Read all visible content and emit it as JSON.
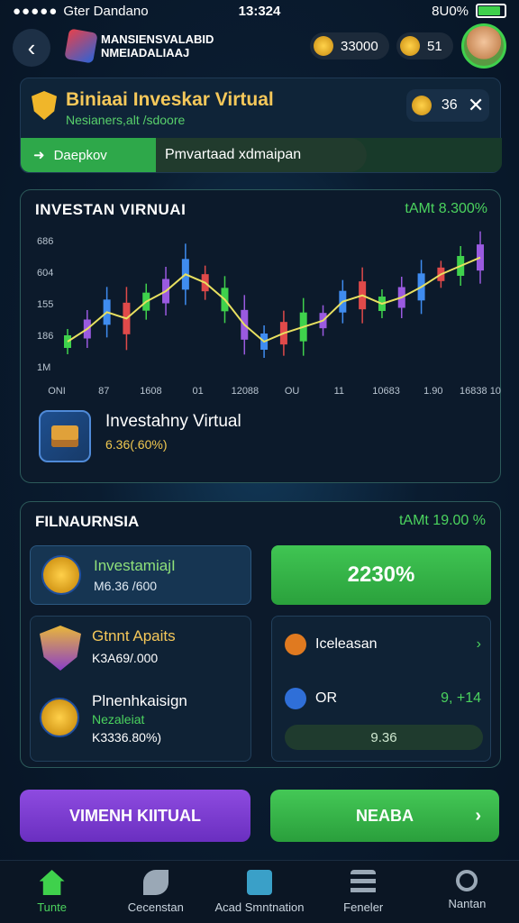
{
  "status_bar": {
    "carrier": "Gter Dandano",
    "time": "13:324",
    "battery": "8U0%"
  },
  "header": {
    "app_name": "MANSIENSVALABID NMEIADALIAAJ",
    "coins": "33000",
    "gems": "51"
  },
  "title_card": {
    "title": "Biniaai Inveskar Virtual",
    "subtitle": "Nesianers,alt /sdoore",
    "badge_value": "36",
    "tabs": [
      {
        "label": "Daepkov"
      },
      {
        "label": "Pmvartaad xdmaipan"
      }
    ]
  },
  "chart_card": {
    "title": "INVESTAN VIRNUAI",
    "percent": "tAMt 8.300%",
    "item_name": "Investahny Virtual",
    "item_value": "6.36(.60%)"
  },
  "chart_data": {
    "type": "line",
    "title": "",
    "y_tick_labels": [
      "1M",
      "186",
      "155",
      "604",
      "686"
    ],
    "x_tick_labels": [
      "ONI",
      "87",
      "1608",
      "01",
      "12088",
      "OU",
      "11",
      "10683",
      "1.90",
      "16838 10"
    ],
    "series": [
      {
        "values": [
          1.2,
          1.8,
          2.6,
          2.3,
          3.1,
          3.6,
          4.4,
          4.0,
          3.2,
          2.0,
          1.2,
          1.6,
          1.9,
          2.2,
          3.1,
          3.4,
          3.0,
          3.3,
          3.8,
          4.4,
          4.8,
          5.2
        ]
      }
    ]
  },
  "fin_card": {
    "title": "FILNAURNSIA",
    "percent": "tAMt 19.00 %",
    "inv_label": "InvestamiajΙ",
    "inv_value": "M6.36 /600",
    "big_value": "2230%",
    "achv_title": "Gtnnt Apaits",
    "achv_value": "K3A69/.000",
    "second_title": "Plnenhkaisign",
    "second_sub": "Nezaleiat",
    "second_value": "K3336.80%)",
    "list": [
      {
        "label": "Iceleasan",
        "trail": "›",
        "color": "#e07a20"
      },
      {
        "label": "OR",
        "trail": "9, +14",
        "color": "#2f6fd8"
      }
    ],
    "mini_value": "9.36"
  },
  "buttons": {
    "left": "VIMENH KIITUAL",
    "right": "NEABA"
  },
  "nav": [
    {
      "label": "Tunte",
      "icon": "home-icon"
    },
    {
      "label": "Cecenstan",
      "icon": "leaf-icon"
    },
    {
      "label": "Acad Smntnation",
      "icon": "card-icon"
    },
    {
      "label": "Feneler",
      "icon": "list-icon"
    },
    {
      "label": "Nantan",
      "icon": "search-icon"
    }
  ],
  "colors": {
    "accent_green": "#3fd14c",
    "gold": "#f5c85a",
    "purple": "#7a3cd0"
  }
}
